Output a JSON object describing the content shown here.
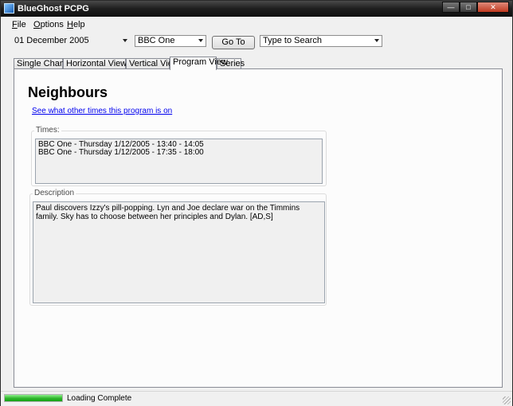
{
  "window": {
    "title": "BlueGhost PCPG"
  },
  "menu": [
    {
      "label": "File",
      "underline": "F",
      "rest": "ile"
    },
    {
      "label": "Options",
      "underline": "O",
      "rest": "ptions"
    },
    {
      "label": "Help",
      "underline": "H",
      "rest": "elp"
    }
  ],
  "toolbar": {
    "date": "01 December 2005",
    "channel": "BBC One",
    "goto_label": "Go To",
    "search_placeholder": "Type to Search"
  },
  "tabs": [
    "Single Channel",
    "Horizontal View",
    "Vertical View",
    "Program View",
    "Series"
  ],
  "active_tab": "Program View",
  "program": {
    "title": "Neighbours",
    "other_times_link": "See what other times this program is on",
    "times_label": "Times:",
    "times": [
      "BBC One - Thursday 1/12/2005 - 13:40 - 14:05",
      "BBC One - Thursday 1/12/2005 - 17:35 - 18:00"
    ],
    "description_label": "Description",
    "description": "Paul discovers Izzy's pill-popping. Lyn and Joe declare war on the Timmins family. Sky has to choose between her principles and Dylan. [AD,S]"
  },
  "status": {
    "text": "Loading Complete",
    "progress": 1.0
  },
  "colors": {
    "accent": "#2db52a",
    "link": "#0000ee",
    "titlebar": "#1e1e1e"
  }
}
